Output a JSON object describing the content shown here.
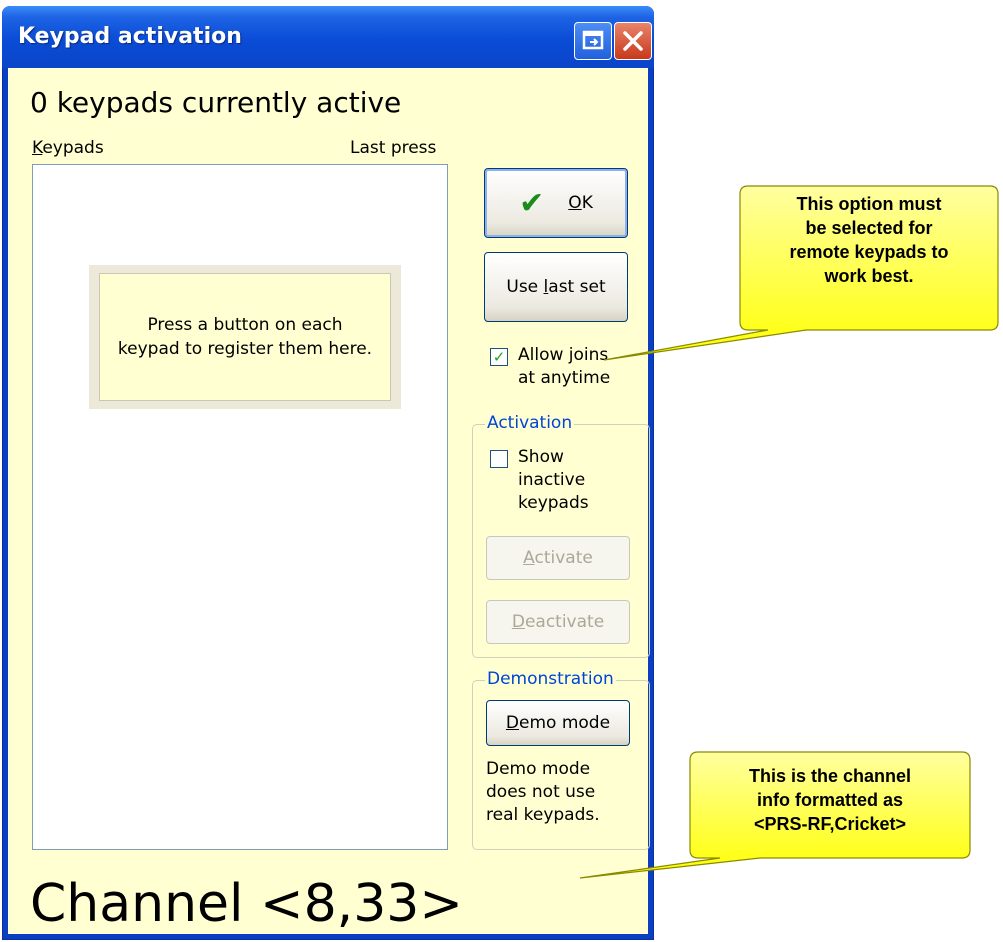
{
  "window": {
    "title": "Keypad activation"
  },
  "status": {
    "active_count": "0 keypads currently active"
  },
  "list": {
    "col_keypads": "Keypads",
    "col_last_press": "Last press",
    "hint": "Press a button on each keypad to register them here."
  },
  "buttons": {
    "ok": "OK",
    "use_last_set": "Use last set",
    "activate": "Activate",
    "deactivate": "Deactivate",
    "demo_mode": "Demo mode"
  },
  "options": {
    "allow_joins_line1": "Allow joins",
    "allow_joins_line2": "at anytime",
    "allow_joins_checked": true
  },
  "activation_group": {
    "legend": "Activation",
    "show_inactive_line1": "Show",
    "show_inactive_line2": "inactive",
    "show_inactive_line3": "keypads",
    "show_inactive_checked": false
  },
  "demo_group": {
    "legend": "Demonstration",
    "note_line1": "Demo mode",
    "note_line2": "does not use",
    "note_line3": "real keypads."
  },
  "channel": {
    "text": "Channel <8,33>"
  },
  "callouts": {
    "option_line1": "This option must",
    "option_line2": "be selected for",
    "option_line3": "remote keypads to",
    "option_line4": "work best.",
    "channel_line1": "This is the channel",
    "channel_line2": "info formatted as",
    "channel_line3": "<PRS-RF,Cricket>"
  },
  "colors": {
    "client_bg": "#ffffd2",
    "titlebar": "#0a4cd6",
    "callout_fill": "#ffff00",
    "legend_text": "#0046d5"
  }
}
